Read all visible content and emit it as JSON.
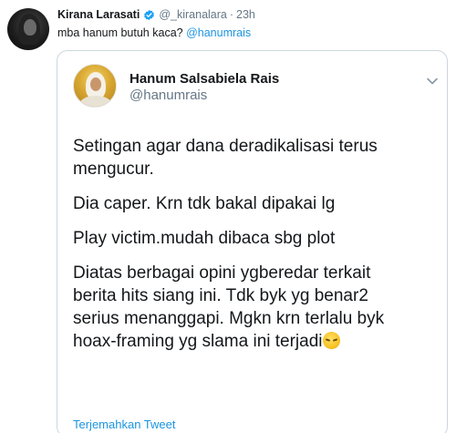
{
  "outer": {
    "name": "Kirana Larasati",
    "handle": "@_kiranalara",
    "separator": "·",
    "time": "23h",
    "text_prefix": "mba hanum butuh kaca?",
    "mention": "@hanumrais"
  },
  "quoted": {
    "name": "Hanum Salsabiela Rais",
    "handle": "@hanumrais",
    "paragraphs": [
      [
        "Setingan agar dana deradikalisasi terus",
        "mengucur."
      ],
      [
        "Dia caper. Krn tdk bakal dipakai lg"
      ],
      [
        "Play victim.mudah dibaca sbg plot"
      ],
      [
        "Diatas berbagai opini ygberedar terkait",
        "berita hits siang ini. Tdk byk yg benar2",
        "serius menanggapi. Mgkn krn terlalu byk",
        "hoax-framing yg slama ini terjadi"
      ]
    ],
    "translate_label": "Terjemahkan Tweet"
  },
  "colors": {
    "link": "#1b95e0",
    "secondary_text": "#657786",
    "border": "#ccd6dd",
    "verified": "#1da1f2"
  },
  "icons": {
    "verified": "verified-badge-icon",
    "chevron": "chevron-down-icon",
    "emoji": "pensive-face-emoji"
  }
}
